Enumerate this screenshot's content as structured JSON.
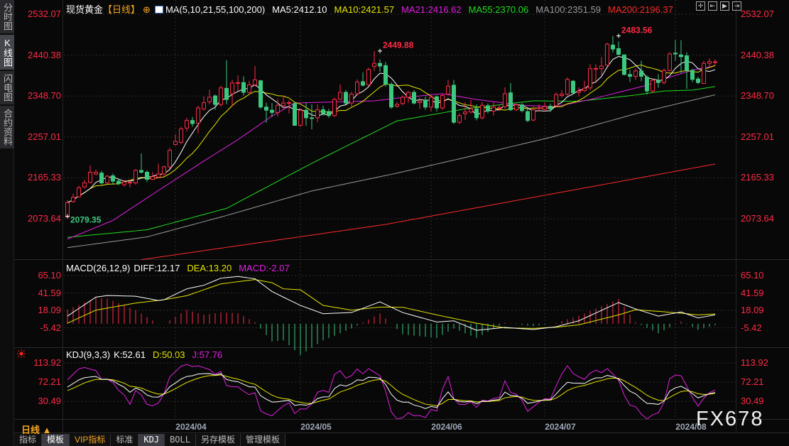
{
  "sidebar": {
    "tabs": [
      {
        "label": "分时图",
        "active": false
      },
      {
        "label": "K线图",
        "active": true
      },
      {
        "label": "闪电图",
        "active": false
      },
      {
        "label": "合约资料",
        "active": false
      }
    ]
  },
  "header": {
    "instrument": "现货黄金",
    "period": "【日线】",
    "ma_label": "MA(5,10,21,55,100,200)",
    "ma_values": [
      {
        "label": "MA5:2412.10",
        "color": "#ffffff"
      },
      {
        "label": "MA10:2421.57",
        "color": "#e6e600"
      },
      {
        "label": "MA21:2416.62",
        "color": "#e020e0"
      },
      {
        "label": "MA55:2370.06",
        "color": "#22dd22"
      },
      {
        "label": "MA100:2351.59",
        "color": "#9a9a9a"
      },
      {
        "label": "MA200:2196.37",
        "color": "#ff2a2a"
      }
    ],
    "tool_icons": [
      "crosshair-icon",
      "step-back-icon",
      "play-icon",
      "jump-end-icon"
    ]
  },
  "macd_header": {
    "name": "MACD(26,12,9)",
    "diff": "DIFF:12.17",
    "dea": "DEA:13.20",
    "macd": "MACD:-2.07"
  },
  "kdj_header": {
    "name": "KDJ(9,3,3)",
    "k": "K:52.61",
    "d": "D:50.03",
    "j": "J:57.76"
  },
  "axis": {
    "main_ticks": [
      "2532.07",
      "2440.38",
      "2348.70",
      "2257.01",
      "2165.33",
      "2073.64"
    ],
    "macd_ticks": [
      "65.10",
      "41.59",
      "18.09",
      "-5.42"
    ],
    "kdj_ticks": [
      "113.92",
      "72.21",
      "30.49"
    ],
    "dates": [
      {
        "label": "2024/04",
        "index": 19
      },
      {
        "label": "2024/05",
        "index": 41
      },
      {
        "label": "2024/06",
        "index": 64
      },
      {
        "label": "2024/07",
        "index": 84
      },
      {
        "label": "2024/08",
        "index": 107
      }
    ]
  },
  "period_selector": "日线 ▲",
  "bottom_tabs": [
    {
      "label": "指标",
      "active": false
    },
    {
      "label": "模板",
      "active": true
    },
    {
      "label": "VIP指标",
      "active": false,
      "vip": true
    },
    {
      "label": "标准",
      "active": false
    },
    {
      "label": "KDJ",
      "active": true
    },
    {
      "label": "BOLL",
      "active": false
    },
    {
      "label": "另存模板",
      "active": false
    },
    {
      "label": "管理模板",
      "active": false
    }
  ],
  "watermark": "FX678",
  "colors": {
    "up": "#ff2a46",
    "down": "#3cc87f",
    "background": "#080808"
  },
  "chart_data": {
    "type": "candlestick",
    "ylim": [
      1983,
      2564
    ],
    "annotations": [
      {
        "label": "2483.56",
        "index": 97,
        "value": 2483.56,
        "kind": "high",
        "color": "#ff2a46"
      },
      {
        "label": "2449.88",
        "index": 55,
        "value": 2449.88,
        "kind": "high",
        "color": "#ff2a46"
      },
      {
        "label": "2079.35",
        "index": 0,
        "value": 2079.35,
        "kind": "low",
        "color": "#3cc87f"
      }
    ],
    "candles_ohlc": [
      [
        2078,
        2115.5,
        2079.35,
        2110
      ],
      [
        2112,
        2130,
        2110,
        2122
      ],
      [
        2123,
        2148,
        2121,
        2143
      ],
      [
        2145,
        2161,
        2141,
        2154
      ],
      [
        2155,
        2193,
        2153,
        2178
      ],
      [
        2174,
        2184,
        2171,
        2178
      ],
      [
        2176,
        2181,
        2150,
        2154
      ],
      [
        2154,
        2172,
        2152,
        2169
      ],
      [
        2170,
        2175,
        2150,
        2158
      ],
      [
        2158,
        2162,
        2149,
        2153
      ],
      [
        2150,
        2160,
        2146,
        2156
      ],
      [
        2155,
        2161,
        2144,
        2155.5
      ],
      [
        2154,
        2185,
        2150,
        2182
      ],
      [
        2182,
        2220,
        2175,
        2178
      ],
      [
        2178,
        2182,
        2156,
        2162
      ],
      [
        2162,
        2178,
        2160,
        2168
      ],
      [
        2167,
        2197,
        2165,
        2174
      ],
      [
        2174,
        2193,
        2170,
        2190
      ],
      [
        2190,
        2233,
        2186,
        2227
      ],
      [
        2240,
        2263,
        2238,
        2247
      ],
      [
        2245,
        2280,
        2241,
        2275
      ],
      [
        2277,
        2300,
        2270,
        2294
      ],
      [
        2294,
        2302,
        2280,
        2287
      ],
      [
        2288,
        2327,
        2265,
        2322
      ],
      [
        2320,
        2348,
        2316,
        2334
      ],
      [
        2336,
        2363,
        2330,
        2346
      ],
      [
        2349,
        2352,
        2318,
        2330
      ],
      [
        2330,
        2372,
        2325,
        2367
      ],
      [
        2366,
        2429,
        2330,
        2341
      ],
      [
        2354,
        2385,
        2325,
        2378
      ],
      [
        2377,
        2395,
        2360,
        2379
      ],
      [
        2379,
        2393,
        2350,
        2357
      ],
      [
        2357,
        2383,
        2352,
        2374
      ],
      [
        2374,
        2416,
        2370,
        2385
      ],
      [
        2383,
        2385,
        2320,
        2324
      ],
      [
        2324,
        2334,
        2289,
        2317
      ],
      [
        2317,
        2333,
        2302,
        2312
      ],
      [
        2312,
        2342,
        2303,
        2328
      ],
      [
        2327,
        2350,
        2320,
        2333
      ],
      [
        2333,
        2340,
        2310,
        2334
      ],
      [
        2332,
        2335,
        2283,
        2283
      ],
      [
        2283,
        2320,
        2280,
        2317
      ],
      [
        2317,
        2334,
        2282,
        2300
      ],
      [
        2300,
        2330,
        2274,
        2299
      ],
      [
        2300,
        2330,
        2290,
        2318
      ],
      [
        2318,
        2327,
        2305,
        2310
      ],
      [
        2314,
        2320,
        2300,
        2305
      ],
      [
        2305,
        2345,
        2302,
        2341
      ],
      [
        2342,
        2375,
        2340,
        2357
      ],
      [
        2357,
        2362,
        2330,
        2333
      ],
      [
        2333,
        2358,
        2325,
        2353
      ],
      [
        2354,
        2386,
        2350,
        2380
      ],
      [
        2381,
        2402,
        2370,
        2373
      ],
      [
        2374,
        2412,
        2372,
        2408
      ],
      [
        2415,
        2449.88,
        2405,
        2422
      ],
      [
        2422,
        2431,
        2403,
        2416
      ],
      [
        2417,
        2425,
        2370,
        2375
      ],
      [
        2375,
        2380,
        2320,
        2324
      ],
      [
        2326,
        2335,
        2322,
        2330
      ],
      [
        2332,
        2350,
        2328,
        2346
      ],
      [
        2346,
        2360,
        2334,
        2357
      ],
      [
        2357,
        2362,
        2330,
        2333
      ],
      [
        2334,
        2345,
        2320,
        2337
      ],
      [
        2340,
        2348,
        2318,
        2324
      ],
      [
        2324,
        2350,
        2314,
        2346
      ],
      [
        2347,
        2350,
        2314,
        2322
      ],
      [
        2322,
        2353,
        2318,
        2350
      ],
      [
        2353,
        2385,
        2351,
        2371
      ],
      [
        2373,
        2385,
        2286,
        2290
      ],
      [
        2290,
        2310,
        2286,
        2305
      ],
      [
        2309,
        2335,
        2295,
        2313
      ],
      [
        2313,
        2340,
        2310,
        2320
      ],
      [
        2320,
        2330,
        2294,
        2300
      ],
      [
        2300,
        2335,
        2296,
        2328
      ],
      [
        2327,
        2332,
        2310,
        2315
      ],
      [
        2315,
        2335,
        2305,
        2324
      ],
      [
        2322,
        2330,
        2315,
        2322.5
      ],
      [
        2325,
        2368,
        2320,
        2354
      ],
      [
        2356,
        2378,
        2315,
        2318
      ],
      [
        2318,
        2332,
        2315,
        2329
      ],
      [
        2329,
        2333,
        2312,
        2316
      ],
      [
        2314,
        2320,
        2290,
        2294
      ],
      [
        2295,
        2325,
        2292,
        2318
      ],
      [
        2322,
        2330,
        2314,
        2322.5
      ],
      [
        2319,
        2335,
        2315,
        2325
      ],
      [
        2326,
        2332,
        2313,
        2320
      ],
      [
        2327,
        2357,
        2325,
        2352
      ],
      [
        2350,
        2362,
        2345,
        2353
      ],
      [
        2353,
        2390,
        2350,
        2386
      ],
      [
        2382,
        2385,
        2352,
        2356
      ],
      [
        2357,
        2368,
        2348,
        2360
      ],
      [
        2361,
        2383,
        2358,
        2366
      ],
      [
        2367,
        2420,
        2362,
        2410
      ],
      [
        2410,
        2420,
        2378,
        2410.5
      ],
      [
        2410,
        2436,
        2395,
        2416
      ],
      [
        2418,
        2468,
        2416,
        2465
      ],
      [
        2463,
        2483.56,
        2446,
        2454
      ],
      [
        2455,
        2471,
        2440,
        2442
      ],
      [
        2441,
        2442,
        2395,
        2397
      ],
      [
        2397,
        2408,
        2380,
        2393
      ],
      [
        2393,
        2410,
        2385,
        2405
      ],
      [
        2405,
        2428,
        2382,
        2393
      ],
      [
        2391,
        2395,
        2352,
        2360
      ],
      [
        2360,
        2387,
        2356,
        2384
      ],
      [
        2384,
        2398,
        2367,
        2379
      ],
      [
        2379,
        2411,
        2375,
        2406
      ],
      [
        2406,
        2447,
        2404,
        2443
      ],
      [
        2445,
        2474,
        2428,
        2443
      ],
      [
        2441,
        2474,
        2400,
        2437
      ],
      [
        2439,
        2447,
        2365,
        2406
      ],
      [
        2406,
        2410,
        2380,
        2386
      ],
      [
        2387,
        2392,
        2376,
        2379
      ],
      [
        2377,
        2428,
        2376,
        2422
      ],
      [
        2422,
        2433,
        2416,
        2426
      ],
      [
        2425,
        2431,
        2418,
        2425.5
      ]
    ],
    "moving_averages": [
      {
        "name": "MA5",
        "color": "#ffffff",
        "period": 5
      },
      {
        "name": "MA10",
        "color": "#e6e600",
        "period": 10
      },
      {
        "name": "MA21",
        "color": "#e020e0",
        "points": [
          [
            0,
            2028
          ],
          [
            8,
            2070
          ],
          [
            16,
            2137
          ],
          [
            24,
            2203
          ],
          [
            30,
            2251
          ],
          [
            36,
            2304
          ],
          [
            40,
            2333
          ],
          [
            48,
            2336
          ],
          [
            54,
            2338
          ],
          [
            58,
            2344
          ],
          [
            66,
            2354
          ],
          [
            72,
            2341
          ],
          [
            80,
            2328
          ],
          [
            86,
            2325
          ],
          [
            92,
            2341
          ],
          [
            97,
            2357
          ],
          [
            102,
            2373
          ],
          [
            106,
            2391
          ],
          [
            110,
            2407
          ],
          [
            114,
            2416.62
          ]
        ]
      },
      {
        "name": "MA55",
        "color": "#22dd22",
        "points": [
          [
            0,
            2032
          ],
          [
            14,
            2049
          ],
          [
            28,
            2097
          ],
          [
            43,
            2198
          ],
          [
            58,
            2293
          ],
          [
            70,
            2320
          ],
          [
            82,
            2338
          ],
          [
            90,
            2337
          ],
          [
            100,
            2351
          ],
          [
            105,
            2360
          ],
          [
            110,
            2362
          ],
          [
            114,
            2370.06
          ]
        ]
      },
      {
        "name": "MA100",
        "color": "#9a9a9a",
        "points": [
          [
            0,
            2009
          ],
          [
            14,
            2033
          ],
          [
            28,
            2081
          ],
          [
            43,
            2136
          ],
          [
            58,
            2176
          ],
          [
            70,
            2211
          ],
          [
            85,
            2256
          ],
          [
            100,
            2309
          ],
          [
            114,
            2351.59
          ]
        ]
      },
      {
        "name": "MA200",
        "color": "#ff2a2a",
        "points": [
          [
            13,
            1982
          ],
          [
            56,
            2061
          ],
          [
            114,
            2196.37
          ]
        ]
      }
    ],
    "macd": {
      "ylim": [
        -32.7,
        72.8
      ],
      "diff": [
        [
          0,
          10.4
        ],
        [
          5,
          36
        ],
        [
          7,
          38.2
        ],
        [
          12,
          37.2
        ],
        [
          16,
          31.5
        ],
        [
          17,
          32.5
        ],
        [
          21,
          47.2
        ],
        [
          24,
          52
        ],
        [
          27,
          61.6
        ],
        [
          30,
          63.9
        ],
        [
          33,
          60.8
        ],
        [
          36,
          43.6
        ],
        [
          38,
          36
        ],
        [
          41,
          24.8
        ],
        [
          45,
          13.6
        ],
        [
          50,
          15.2
        ],
        [
          55,
          29.6
        ],
        [
          59,
          15.2
        ],
        [
          65,
          2.4
        ],
        [
          68,
          4
        ],
        [
          72,
          -8.8
        ],
        [
          77,
          -4.9
        ],
        [
          82,
          -7.8
        ],
        [
          86,
          -4
        ],
        [
          90,
          4
        ],
        [
          97,
          28.7
        ],
        [
          100,
          20
        ],
        [
          104,
          10.4
        ],
        [
          108,
          15.9
        ],
        [
          111,
          7.9
        ],
        [
          114,
          12.17
        ]
      ],
      "dea": [
        [
          0,
          0.8
        ],
        [
          5,
          18.4
        ],
        [
          12,
          28
        ],
        [
          17,
          32.5
        ],
        [
          21,
          37.9
        ],
        [
          27,
          53.9
        ],
        [
          33,
          59.7
        ],
        [
          36,
          55.5
        ],
        [
          38,
          47.2
        ],
        [
          41,
          45.9
        ],
        [
          45,
          24.8
        ],
        [
          50,
          18.4
        ],
        [
          55,
          22.6
        ],
        [
          59,
          22.3
        ],
        [
          65,
          12
        ],
        [
          72,
          0.8
        ],
        [
          77,
          -5.6
        ],
        [
          82,
          -6.2
        ],
        [
          86,
          -4.6
        ],
        [
          90,
          -1.4
        ],
        [
          97,
          12
        ],
        [
          100,
          19
        ],
        [
          104,
          16.8
        ],
        [
          108,
          14.3
        ],
        [
          111,
          12
        ],
        [
          114,
          13.2
        ]
      ]
    },
    "kdj": {
      "ylim": [
        -8,
        128
      ],
      "colors": {
        "k": "#ffffff",
        "d": "#e6e600",
        "j": "#e020e0"
      }
    }
  }
}
